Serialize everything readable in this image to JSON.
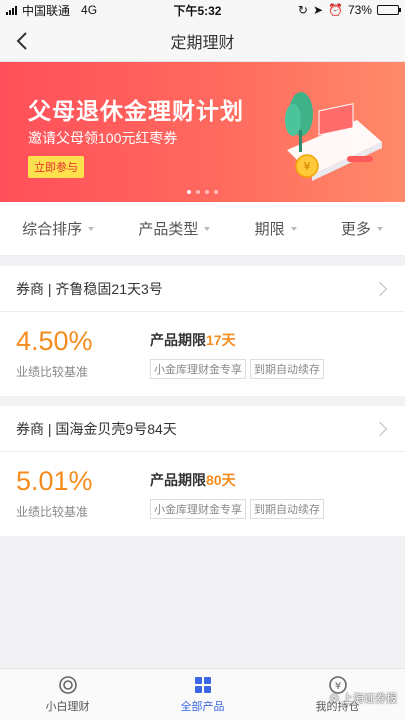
{
  "status_bar": {
    "carrier": "中国联通",
    "network": "4G",
    "time": "下午5:32",
    "battery_percent": "73%",
    "battery_level": 0.73
  },
  "nav": {
    "title": "定期理财"
  },
  "banner": {
    "title": "父母退休金理财计划",
    "subtitle": "邀请父母领100元红枣券",
    "button_label": "立即参与",
    "dot_count": 4,
    "active_dot": 0,
    "colors": {
      "primary": "#ff4f5a",
      "button": "#ffe14d"
    }
  },
  "filters": [
    {
      "label": "综合排序"
    },
    {
      "label": "产品类型"
    },
    {
      "label": "期限"
    },
    {
      "label": "更多"
    }
  ],
  "products": [
    {
      "name": "券商 | 齐鲁稳固21天3号",
      "rate": "4.50%",
      "rate_label": "业绩比较基准",
      "term_label": "产品期限",
      "term_value": "17天",
      "tags": [
        "小金库理财金专享",
        "到期自动续存"
      ]
    },
    {
      "name": "券商 | 国海金贝壳9号84天",
      "rate": "5.01%",
      "rate_label": "业绩比较基准",
      "term_label": "产品期限",
      "term_value": "80天",
      "tags": [
        "小金库理财金专享",
        "到期自动续存"
      ]
    }
  ],
  "tabbar": [
    {
      "label": "小白理财",
      "icon": "target-icon",
      "active": false
    },
    {
      "label": "全部产品",
      "icon": "grid-icon",
      "active": true
    },
    {
      "label": "我的持仓",
      "icon": "yuan-coin-icon",
      "active": false
    }
  ],
  "watermark": "上海证券报",
  "accent_color": "#f48c1e",
  "tab_active_color": "#3b66e6"
}
